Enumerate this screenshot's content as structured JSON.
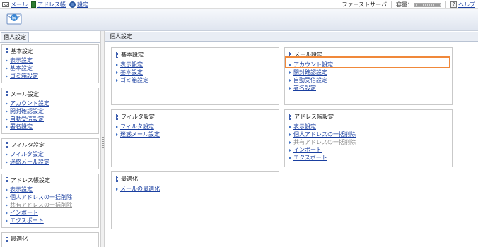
{
  "topbar": {
    "mail_label": "メール",
    "address_label": "アドレス帳",
    "settings_label": "設定",
    "server_label": "ファーストサーバ",
    "capacity_label": "容量：",
    "help_label": "ヘルプ"
  },
  "header": {
    "app_icon_glyph": "@"
  },
  "left": {
    "tab_label": "個人設定",
    "sections": [
      {
        "title": "基本設定",
        "items": [
          {
            "label": "表示設定",
            "dim": false
          },
          {
            "label": "基本設定",
            "dim": false
          },
          {
            "label": "ゴミ箱設定",
            "dim": false
          }
        ]
      },
      {
        "title": "メール設定",
        "items": [
          {
            "label": "アカウント設定",
            "dim": false
          },
          {
            "label": "開封確認設定",
            "dim": false
          },
          {
            "label": "自動受信設定",
            "dim": false
          },
          {
            "label": "署名設定",
            "dim": false
          }
        ]
      },
      {
        "title": "フィルタ設定",
        "items": [
          {
            "label": "フィルタ設定",
            "dim": false
          },
          {
            "label": "迷惑メール設定",
            "dim": false
          }
        ]
      },
      {
        "title": "アドレス帳設定",
        "items": [
          {
            "label": "表示設定",
            "dim": false
          },
          {
            "label": "個人アドレスの一括削除",
            "dim": false
          },
          {
            "label": "共有アドレスの一括削除",
            "dim": true
          },
          {
            "label": "インポート",
            "dim": false
          },
          {
            "label": "エクスポート",
            "dim": false
          }
        ]
      },
      {
        "title": "最適化",
        "items": []
      }
    ]
  },
  "main": {
    "header_title": "個人設定",
    "boxes": [
      {
        "title": "基本設定",
        "items": [
          {
            "label": "表示設定",
            "dim": false
          },
          {
            "label": "基本設定",
            "dim": false
          },
          {
            "label": "ゴミ箱設定",
            "dim": false
          }
        ]
      },
      {
        "title": "メール設定",
        "items": [
          {
            "label": "アカウント設定",
            "dim": false
          },
          {
            "label": "開封確認設定",
            "dim": false
          },
          {
            "label": "自動受信設定",
            "dim": false
          },
          {
            "label": "署名設定",
            "dim": false
          }
        ]
      },
      {
        "title": "フィルタ設定",
        "items": [
          {
            "label": "フィルタ設定",
            "dim": false
          },
          {
            "label": "迷惑メール設定",
            "dim": false
          }
        ]
      },
      {
        "title": "アドレス帳設定",
        "items": [
          {
            "label": "表示設定",
            "dim": false
          },
          {
            "label": "個人アドレスの一括削除",
            "dim": false
          },
          {
            "label": "共有アドレスの一括削除",
            "dim": true
          },
          {
            "label": "インポート",
            "dim": false
          },
          {
            "label": "エクスポート",
            "dim": false
          }
        ]
      },
      {
        "title": "最適化",
        "items": [
          {
            "label": "メールの最適化",
            "dim": false
          }
        ]
      }
    ]
  },
  "colors": {
    "link": "#1a3fa0",
    "highlight": "#f0883a",
    "dim": "#8a8a8a"
  }
}
